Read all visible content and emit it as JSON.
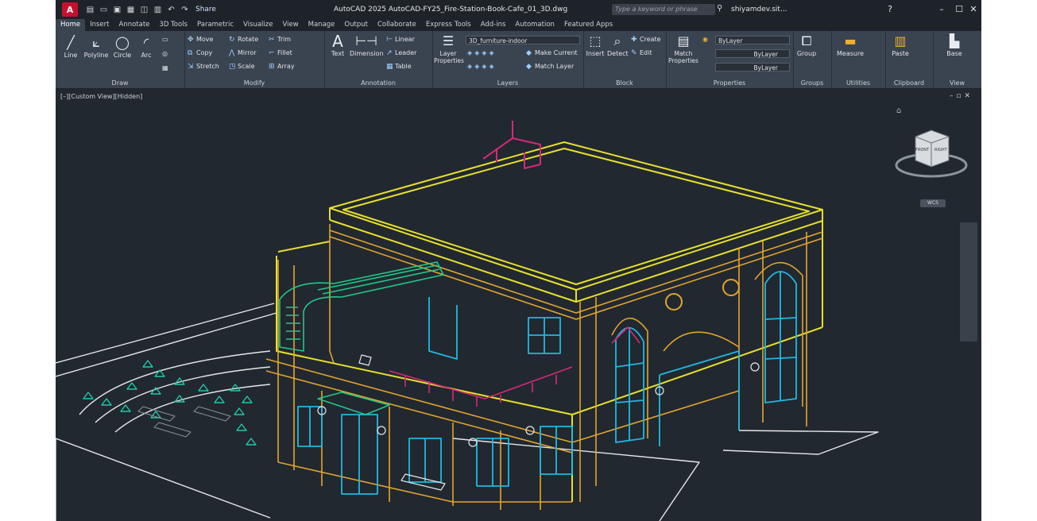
{
  "app": {
    "logo": "A",
    "share_label": "Share",
    "window_title": "AutoCAD 2025   AutoCAD-FY25_Fire-Station-Book-Cafe_01_3D.dwg",
    "search_placeholder": "Type a keyword or phrase",
    "user": "shiyamdev.sit..."
  },
  "tabs": [
    "Home",
    "Insert",
    "Annotate",
    "3D Tools",
    "Parametric",
    "Visualize",
    "View",
    "Manage",
    "Output",
    "Collaborate",
    "Express Tools",
    "Add-ins",
    "Automation",
    "Featured Apps"
  ],
  "ribbon": {
    "draw": {
      "title": "Draw",
      "tools": [
        "Line",
        "Polyline",
        "Circle",
        "Arc"
      ]
    },
    "modify": {
      "title": "Modify",
      "tools": [
        "Move",
        "Rotate",
        "Trim",
        "Copy",
        "Mirror",
        "Fillet",
        "Stretch",
        "Scale",
        "Array"
      ]
    },
    "annotation": {
      "title": "Annotation",
      "text": "Text",
      "dimension": "Dimension",
      "linear": "Linear",
      "leader": "Leader",
      "table": "Table"
    },
    "layers": {
      "title": "Layers",
      "layer_properties": "Layer Properties",
      "current_layer": "3D_furniture-indoor",
      "make_current": "Make Current",
      "match_layer": "Match Layer"
    },
    "block": {
      "title": "Block",
      "insert": "Insert",
      "detect": "Detect",
      "create": "Create",
      "edit": "Edit"
    },
    "properties": {
      "title": "Properties",
      "match_properties": "Match Properties",
      "color": "ByLayer",
      "linetype": "ByLayer",
      "lineweight": "ByLayer"
    },
    "groups": {
      "title": "Groups",
      "group": "Group"
    },
    "utilities": {
      "title": "Utilities",
      "measure": "Measure"
    },
    "clipboard": {
      "title": "Clipboard",
      "paste": "Paste"
    },
    "view": {
      "title": "View",
      "base": "Base"
    }
  },
  "viewport": {
    "label": "[–][Custom View][Hidden]",
    "viewcube_front": "FRONT",
    "viewcube_right": "RIGHT",
    "wcs": "WCS"
  },
  "colors": {
    "yellow": "#e8e02a",
    "orange": "#e3a52c",
    "cyan": "#21b8e0",
    "green": "#1fc98a",
    "magenta": "#d6287a",
    "white": "#e6e8ea"
  }
}
